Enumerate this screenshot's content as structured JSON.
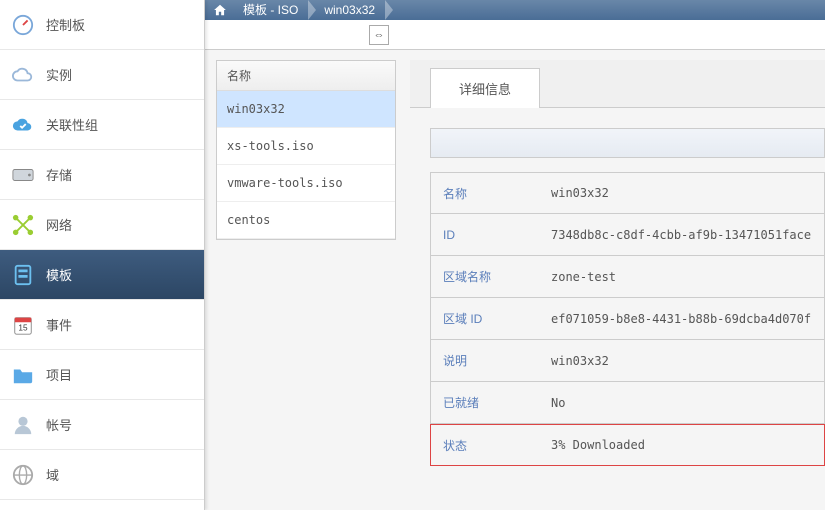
{
  "breadcrumb": {
    "seg1": "模板 - ISO",
    "seg2": "win03x32"
  },
  "sidebar": {
    "items": [
      {
        "label": "控制板"
      },
      {
        "label": "实例"
      },
      {
        "label": "关联性组"
      },
      {
        "label": "存储"
      },
      {
        "label": "网络"
      },
      {
        "label": "模板"
      },
      {
        "label": "事件"
      },
      {
        "label": "项目"
      },
      {
        "label": "帐号"
      },
      {
        "label": "域"
      }
    ]
  },
  "list": {
    "header": "名称",
    "rows": [
      {
        "name": "win03x32"
      },
      {
        "name": "xs-tools.iso"
      },
      {
        "name": "vmware-tools.iso"
      },
      {
        "name": "centos"
      }
    ]
  },
  "tabs": {
    "details": "详细信息"
  },
  "details": {
    "name_label": "名称",
    "name_value": "win03x32",
    "id_label": "ID",
    "id_value": "7348db8c-c8df-4cbb-af9b-13471051face",
    "zonename_label": "区域名称",
    "zonename_value": "zone-test",
    "zoneid_label": "区域 ID",
    "zoneid_value": "ef071059-b8e8-4431-b88b-69dcba4d070f",
    "desc_label": "说明",
    "desc_value": "win03x32",
    "ready_label": "已就绪",
    "ready_value": "No",
    "status_label": "状态",
    "status_value": "3% Downloaded"
  }
}
